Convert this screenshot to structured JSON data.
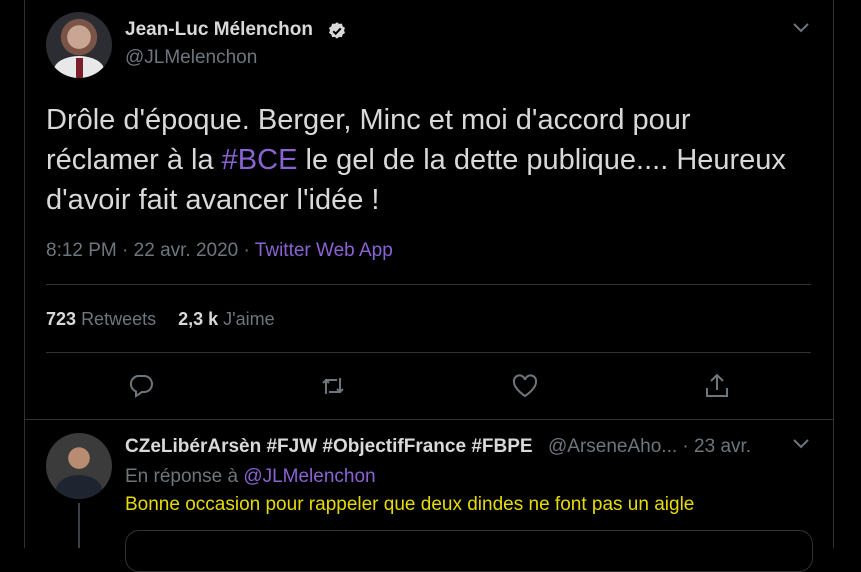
{
  "tweet": {
    "author_name": "Jean-Luc Mélenchon",
    "author_handle": "@JLMelenchon",
    "text_part1": "Drôle d'époque. Berger, Minc et moi d'accord pour réclamer à la ",
    "hashtag": "#BCE",
    "text_part2": " le gel de la dette publique.... Heureux d'avoir fait avancer l'idée !",
    "time": "8:12 PM",
    "date": "22 avr. 2020",
    "separator": "·",
    "source": "Twitter Web App",
    "retweets_count": "723",
    "retweets_label": "Retweets",
    "likes_count": "2,3 k",
    "likes_label": "J'aime"
  },
  "actions": {
    "reply_icon": "reply-icon",
    "retweet_icon": "retweet-icon",
    "like_icon": "like-icon",
    "share_icon": "share-icon"
  },
  "reply": {
    "author_name": "CZeLibérArsèn #FJW #ObjectifFrance #FBPE",
    "author_handle": "@ArseneAho...",
    "separator": "·",
    "date": "23 avr.",
    "in_reply_prefix": "En réponse à",
    "in_reply_mention": "@JLMelenchon",
    "text": "Bonne occasion pour rappeler que deux dindes ne font pas un aigle"
  },
  "colors": {
    "background": "#000000",
    "link": "#8a63d2",
    "muted": "#6e767d",
    "reply_text": "#e6db00"
  }
}
